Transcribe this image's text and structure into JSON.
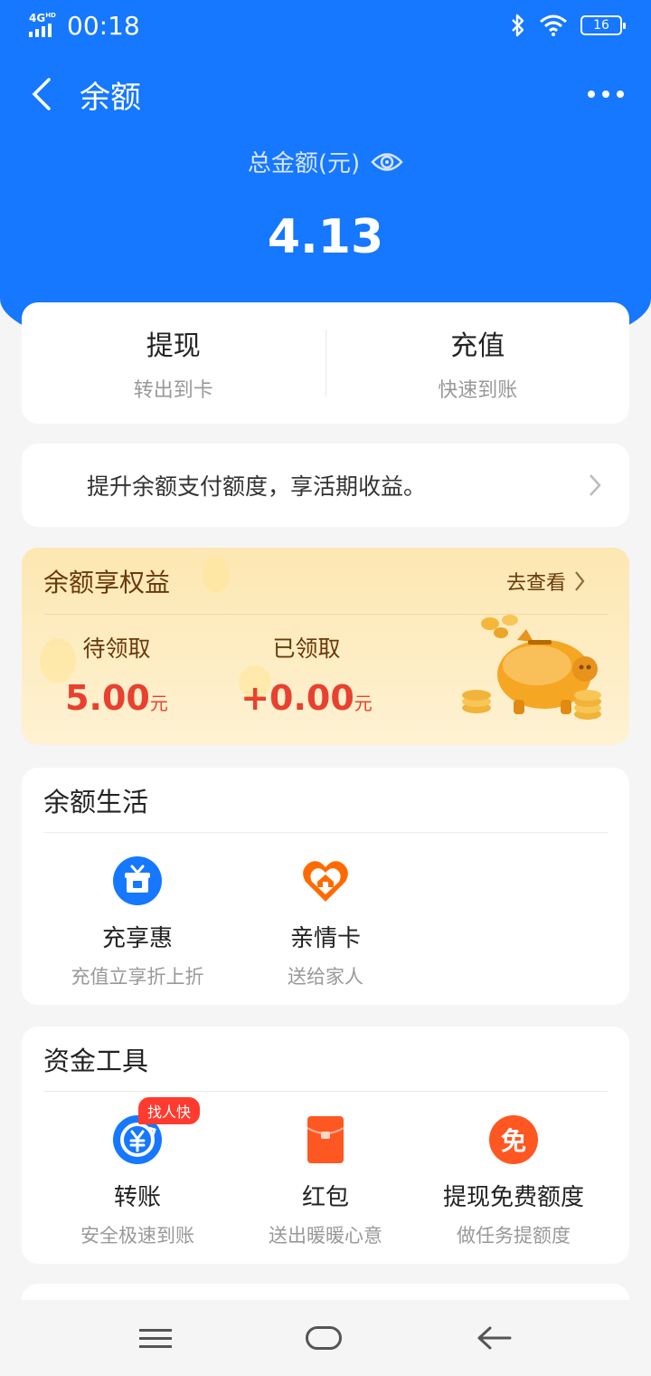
{
  "status_bar": {
    "network": "4G",
    "network_sub": "HD",
    "time": "00:18",
    "battery": "16"
  },
  "nav": {
    "title": "余额"
  },
  "balance": {
    "label": "总金额(元)",
    "amount": "4.13"
  },
  "actions": [
    {
      "title": "提现",
      "subtitle": "转出到卡"
    },
    {
      "title": "充值",
      "subtitle": "快速到账"
    }
  ],
  "promo": {
    "text": "提升余额支付额度，享活期收益。"
  },
  "rights": {
    "title": "余额享权益",
    "link": "去查看",
    "pending": {
      "label": "待领取",
      "value": "5.00",
      "unit": "元"
    },
    "received": {
      "label": "已领取",
      "value": "+0.00",
      "unit": "元"
    }
  },
  "life": {
    "title": "余额生活",
    "items": [
      {
        "name": "充享惠",
        "desc": "充值立享折上折",
        "icon": "gift-icon",
        "color": "#1677ff"
      },
      {
        "name": "亲情卡",
        "desc": "送给家人",
        "icon": "heart-home-icon",
        "color": "#ff6a00"
      }
    ]
  },
  "tools": {
    "title": "资金工具",
    "items": [
      {
        "name": "转账",
        "desc": "安全极速到账",
        "icon": "transfer-icon",
        "badge": "找人快",
        "color": "#1677ff"
      },
      {
        "name": "红包",
        "desc": "送出暖暖心意",
        "icon": "red-packet-icon",
        "color": "#ff5722"
      },
      {
        "name": "提现免费额度",
        "desc": "做任务提额度",
        "icon": "free-icon",
        "glyph": "免",
        "color": "#ff5722"
      }
    ]
  },
  "colors": {
    "primary": "#1677ff",
    "accent_red": "#e8412f",
    "gold": "#6a3a0a"
  }
}
